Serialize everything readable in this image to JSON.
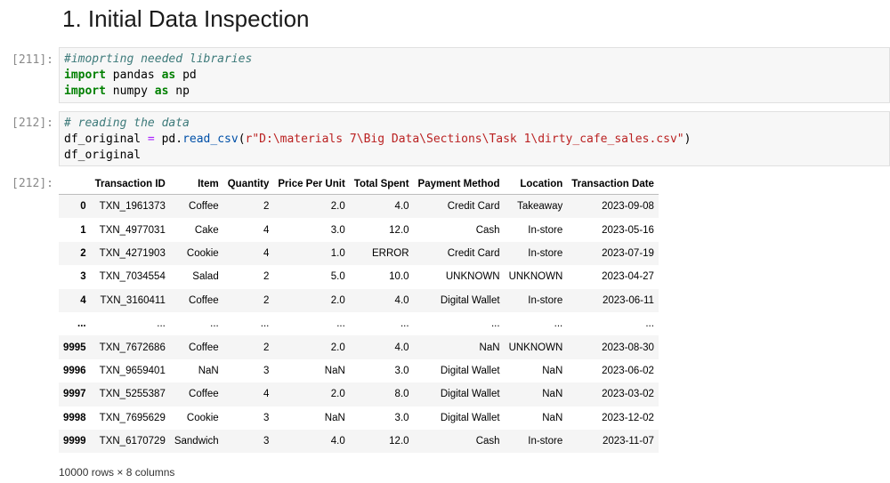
{
  "notebook": {
    "heading": "1. Initial Data Inspection",
    "cells": [
      {
        "prompt": "[211]:",
        "lines": [
          [
            {
              "t": "#imoprting needed libraries",
              "c": "cm"
            }
          ],
          [
            {
              "t": "import",
              "c": "kw"
            },
            {
              "t": " pandas ",
              "c": ""
            },
            {
              "t": "as",
              "c": "kw"
            },
            {
              "t": " pd",
              "c": ""
            }
          ],
          [
            {
              "t": "import",
              "c": "kw"
            },
            {
              "t": " numpy ",
              "c": ""
            },
            {
              "t": "as",
              "c": "kw"
            },
            {
              "t": " np",
              "c": ""
            }
          ]
        ]
      },
      {
        "prompt": "[212]:",
        "lines": [
          [
            {
              "t": "# reading the data",
              "c": "cm"
            }
          ],
          [
            {
              "t": "df_original ",
              "c": ""
            },
            {
              "t": "=",
              "c": "op"
            },
            {
              "t": " pd.",
              "c": ""
            },
            {
              "t": "read_csv",
              "c": "fn"
            },
            {
              "t": "(",
              "c": ""
            },
            {
              "t": "r\"D:\\materials 7\\Big Data\\Sections\\Task 1\\dirty_cafe_sales.csv\"",
              "c": "str"
            },
            {
              "t": ")",
              "c": ""
            }
          ],
          [
            {
              "t": "df_original",
              "c": ""
            }
          ]
        ]
      }
    ],
    "output_prompt": "[212]:",
    "table": {
      "columns": [
        "",
        "Transaction ID",
        "Item",
        "Quantity",
        "Price Per Unit",
        "Total Spent",
        "Payment Method",
        "Location",
        "Transaction Date"
      ],
      "rows": [
        [
          "0",
          "TXN_1961373",
          "Coffee",
          "2",
          "2.0",
          "4.0",
          "Credit Card",
          "Takeaway",
          "2023-09-08"
        ],
        [
          "1",
          "TXN_4977031",
          "Cake",
          "4",
          "3.0",
          "12.0",
          "Cash",
          "In-store",
          "2023-05-16"
        ],
        [
          "2",
          "TXN_4271903",
          "Cookie",
          "4",
          "1.0",
          "ERROR",
          "Credit Card",
          "In-store",
          "2023-07-19"
        ],
        [
          "3",
          "TXN_7034554",
          "Salad",
          "2",
          "5.0",
          "10.0",
          "UNKNOWN",
          "UNKNOWN",
          "2023-04-27"
        ],
        [
          "4",
          "TXN_3160411",
          "Coffee",
          "2",
          "2.0",
          "4.0",
          "Digital Wallet",
          "In-store",
          "2023-06-11"
        ],
        [
          "...",
          "...",
          "...",
          "...",
          "...",
          "...",
          "...",
          "...",
          "..."
        ],
        [
          "9995",
          "TXN_7672686",
          "Coffee",
          "2",
          "2.0",
          "4.0",
          "NaN",
          "UNKNOWN",
          "2023-08-30"
        ],
        [
          "9996",
          "TXN_9659401",
          "NaN",
          "3",
          "NaN",
          "3.0",
          "Digital Wallet",
          "NaN",
          "2023-06-02"
        ],
        [
          "9997",
          "TXN_5255387",
          "Coffee",
          "4",
          "2.0",
          "8.0",
          "Digital Wallet",
          "NaN",
          "2023-03-02"
        ],
        [
          "9998",
          "TXN_7695629",
          "Cookie",
          "3",
          "NaN",
          "3.0",
          "Digital Wallet",
          "NaN",
          "2023-12-02"
        ],
        [
          "9999",
          "TXN_6170729",
          "Sandwich",
          "3",
          "4.0",
          "12.0",
          "Cash",
          "In-store",
          "2023-11-07"
        ]
      ],
      "summary": "10000 rows × 8 columns"
    }
  }
}
